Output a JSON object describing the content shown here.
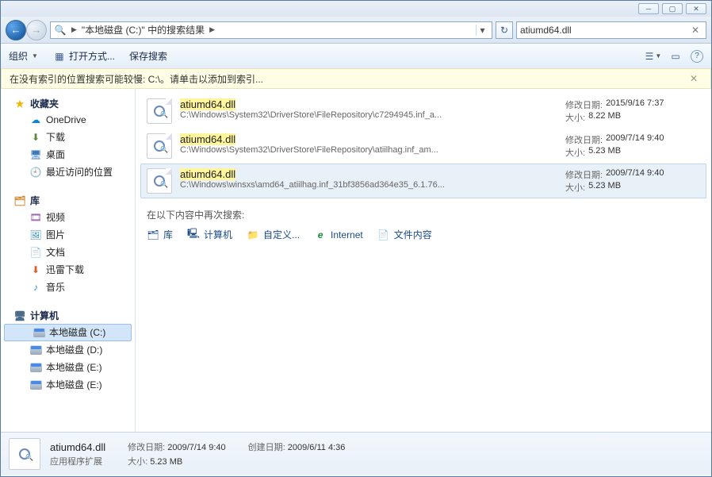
{
  "window": {
    "title": ""
  },
  "nav": {
    "addr_root": "\"本地磁盘 (C:)\" 中的搜索结果",
    "search_value": "atiumd64.dll"
  },
  "toolbar": {
    "organize": "组织",
    "open_with": "打开方式...",
    "save_search": "保存搜索"
  },
  "infobar": {
    "text": "在没有索引的位置搜索可能较慢: C:\\。请单击以添加到索引..."
  },
  "sidebar": {
    "favorites_label": "收藏夹",
    "favorites": [
      {
        "label": "OneDrive",
        "icon": "cloud"
      },
      {
        "label": "下载",
        "icon": "dl"
      },
      {
        "label": "桌面",
        "icon": "desk"
      },
      {
        "label": "最近访问的位置",
        "icon": "recent"
      }
    ],
    "libraries_label": "库",
    "libraries": [
      {
        "label": "视频",
        "icon": "vid"
      },
      {
        "label": "图片",
        "icon": "pic"
      },
      {
        "label": "文档",
        "icon": "doc"
      },
      {
        "label": "迅雷下载",
        "icon": "xl"
      },
      {
        "label": "音乐",
        "icon": "mus"
      }
    ],
    "computer_label": "计算机",
    "drives": [
      {
        "label": "本地磁盘 (C:)",
        "selected": true
      },
      {
        "label": "本地磁盘 (D:)",
        "selected": false
      },
      {
        "label": "本地磁盘 (E:)",
        "selected": false
      },
      {
        "label": "本地磁盘 (E:)",
        "selected": false
      }
    ]
  },
  "results": [
    {
      "name": "atiumd64.dll",
      "path": "C:\\Windows\\System32\\DriverStore\\FileRepository\\c7294945.inf_a...",
      "date_label": "修改日期:",
      "date": "2015/9/16 7:37",
      "size_label": "大小:",
      "size": "8.22 MB",
      "selected": false
    },
    {
      "name": "atiumd64.dll",
      "path": "C:\\Windows\\System32\\DriverStore\\FileRepository\\atiilhag.inf_am...",
      "date_label": "修改日期:",
      "date": "2009/7/14 9:40",
      "size_label": "大小:",
      "size": "5.23 MB",
      "selected": false
    },
    {
      "name": "atiumd64.dll",
      "path": "C:\\Windows\\winsxs\\amd64_atiilhag.inf_31bf3856ad364e35_6.1.76...",
      "date_label": "修改日期:",
      "date": "2009/7/14 9:40",
      "size_label": "大小:",
      "size": "5.23 MB",
      "selected": true
    }
  ],
  "search_again": {
    "header": "在以下内容中再次搜索:",
    "items": [
      {
        "label": "库",
        "icon": "lib"
      },
      {
        "label": "计算机",
        "icon": "pc"
      },
      {
        "label": "自定义...",
        "icon": "custom"
      },
      {
        "label": "Internet",
        "icon": "ie"
      },
      {
        "label": "文件内容",
        "icon": "filecontent"
      }
    ]
  },
  "details": {
    "name": "atiumd64.dll",
    "type": "应用程序扩展",
    "mod_label": "修改日期:",
    "mod_value": "2009/7/14 9:40",
    "size_label": "大小:",
    "size_value": "5.23 MB",
    "create_label": "创建日期:",
    "create_value": "2009/6/11 4:36"
  }
}
